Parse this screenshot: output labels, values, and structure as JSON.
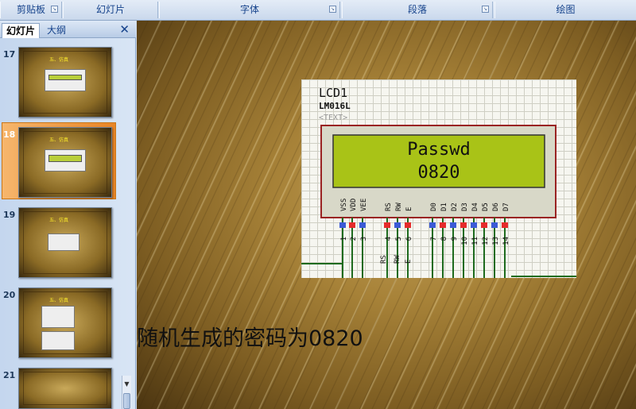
{
  "ribbon": {
    "groups": [
      "剪贴板",
      "幻灯片",
      "字体",
      "段落",
      "绘图"
    ]
  },
  "panel": {
    "tabs": [
      "幻灯片",
      "大纲"
    ],
    "selected_slide": "18",
    "slides": [
      {
        "number": "17",
        "title": "五、仿真"
      },
      {
        "number": "18",
        "title": "五、仿真"
      },
      {
        "number": "19",
        "title": "五、仿真"
      },
      {
        "number": "20",
        "title": "五、仿真"
      },
      {
        "number": "21",
        "title": ""
      }
    ]
  },
  "slide": {
    "lcd": {
      "ref": "LCD1",
      "part": "LM016L",
      "text_tag": "<TEXT>",
      "line1": "Passwd",
      "line2": "0820",
      "pins": [
        "VSS",
        "VDD",
        "VEE",
        "RS",
        "RW",
        "E",
        "D0",
        "D1",
        "D2",
        "D3",
        "D4",
        "D5",
        "D6",
        "D7"
      ],
      "pin_numbers": [
        "1",
        "2",
        "3",
        "4",
        "5",
        "6",
        "7",
        "8",
        "9",
        "10",
        "11",
        "12",
        "13",
        "14"
      ],
      "bottom_labels": [
        "RS",
        "RW",
        "E"
      ]
    },
    "caption": "随机生成的密码为0820"
  },
  "colors": {
    "lcd_screen": "#a9c317",
    "lcd_frame": "#9a2323",
    "pin_red": "#e52b2b",
    "pin_blue": "#3c5bd6",
    "wire": "#1e6b1e"
  }
}
